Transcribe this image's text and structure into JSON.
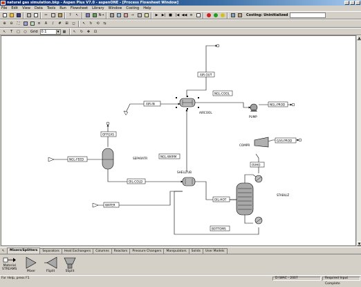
{
  "window": {
    "title": "natural gas simulation.bkp - Aspen Plus V7.0 - aspenONE - [Process Flowsheet Window]"
  },
  "menu": [
    "File",
    "Edit",
    "View",
    "Data",
    "Tools",
    "Run",
    "Flowsheet",
    "Library",
    "Window",
    "Costing",
    "Help"
  ],
  "toolbar": {
    "costing_status": "Costing: Uninitialized",
    "grid_label": "Grid",
    "grid_value": "0.1"
  },
  "flowsheet": {
    "streams": {
      "air_out": "AIR-OUT",
      "ngl_cool": "NGL-COOL",
      "air_in": "AIR-IN",
      "ngl_prod": "NGL-PROD",
      "off_gas": "OFFGAS",
      "ngl_warm": "NGL-WARM",
      "ngl_feed": "NGL-FEED",
      "oil_cold": "OIL-COLD",
      "water": "WATER",
      "oil_hot": "OIL-HOT",
      "gas_prod": "GAS-PROD",
      "ovhd": "OVHD",
      "bottoms": "BOTTOMS"
    },
    "blocks": {
      "aircool": "AIRCOOL",
      "pump": "PUMP",
      "separatr": "SEPARATR",
      "shelltub": "SHELLTUB",
      "compr": "COMPR",
      "stabiliz": "STABILIZ"
    }
  },
  "palette": {
    "tabs": [
      "Mixers/Splitters",
      "Separators",
      "Heat Exchangers",
      "Columns",
      "Reactors",
      "Pressure Changers",
      "Manipulators",
      "Solids",
      "User Models"
    ],
    "active_tab": "Mixers/Splitters",
    "items": {
      "material": "Material",
      "streams": "STREAMS",
      "mixer": "Mixer",
      "fsplit": "FSplit",
      "ssplit": "SSplit"
    }
  },
  "statusbar": {
    "help": "For Help, press F1",
    "path": "D:\\WAC - 2007",
    "status": "Required Input Complete"
  },
  "colors": {
    "title_gradient_start": "#0a246a",
    "canvas": "#ffffff",
    "chrome": "#d4d0c8",
    "run_green": "#20a020",
    "stop_red": "#d02020"
  }
}
